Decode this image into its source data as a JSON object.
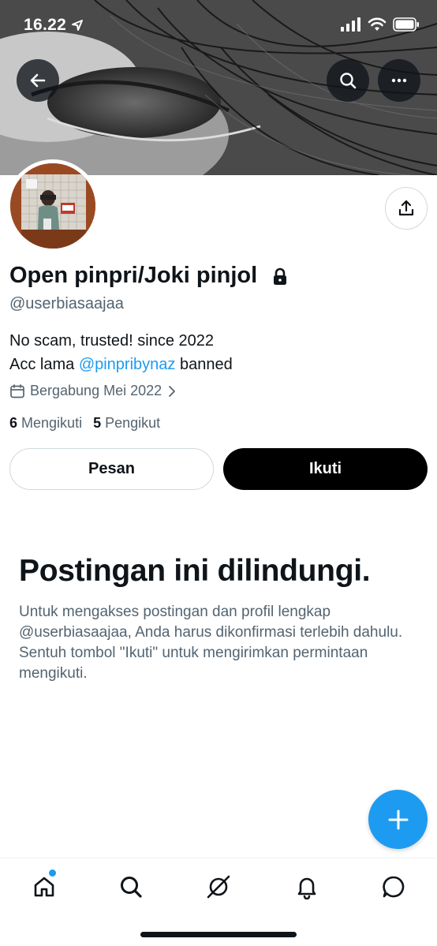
{
  "status_bar": {
    "time": "16.22",
    "icons": [
      "location-arrow-icon",
      "signal-icon",
      "wifi-icon",
      "battery-icon"
    ]
  },
  "header": {
    "back_icon": "arrow-left-icon",
    "search_icon": "search-icon",
    "more_icon": "more-horizontal-icon"
  },
  "profile": {
    "display_name": "Open pinpri/Joki pinjol",
    "protected_icon": "lock-icon",
    "handle": "@userbiasaajaa",
    "bio_line1": "No scam, trusted! since 2022",
    "bio_line2_prefix": "Acc lama ",
    "bio_mention": "@pinpribynaz",
    "bio_line2_suffix": " banned",
    "joined": "Bergabung Mei 2022",
    "following_count": "6",
    "following_label": "Mengikuti",
    "followers_count": "5",
    "followers_label": "Pengikut"
  },
  "actions": {
    "message_label": "Pesan",
    "follow_label": "Ikuti"
  },
  "protected_notice": {
    "title": "Postingan ini dilindungi.",
    "body": "Untuk mengakses postingan dan profil lengkap @userbiasaajaa, Anda harus dikonfirmasi terlebih dahulu. Sentuh tombol \"Ikuti\" untuk mengirimkan permintaan mengikuti."
  },
  "fab": {
    "icon": "plus-icon"
  },
  "bottom_nav": {
    "items": [
      "home-icon",
      "search-icon",
      "grok-icon",
      "notifications-icon",
      "messages-icon"
    ],
    "home_has_badge": true
  },
  "colors": {
    "accent": "#1d9bf0",
    "text_primary": "#0f1419",
    "text_secondary": "#536471",
    "border": "#cfd9de"
  }
}
